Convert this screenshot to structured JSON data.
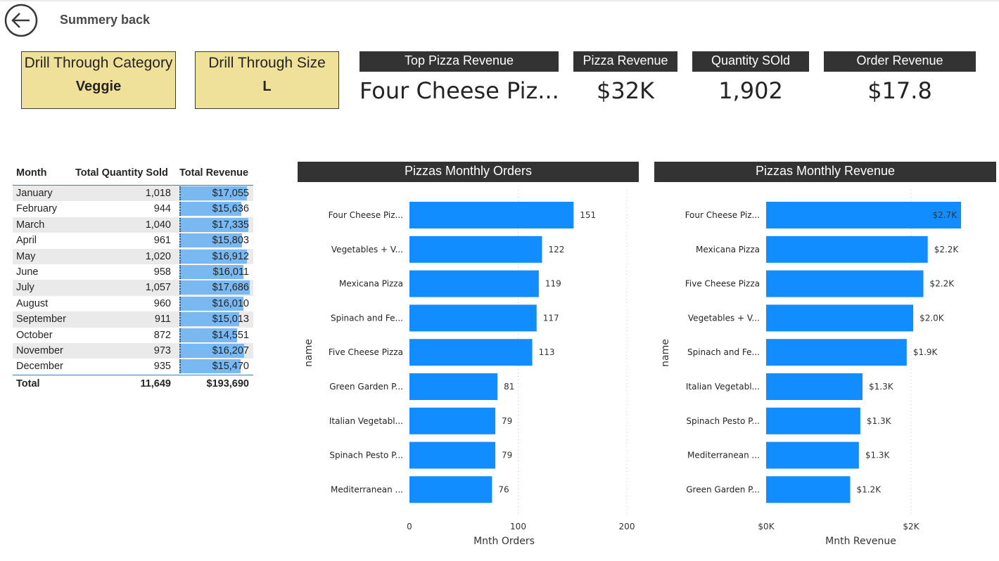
{
  "nav": {
    "back_label": "Summery back"
  },
  "drill": [
    {
      "title": "Drill Through Category",
      "value": "Veggie"
    },
    {
      "title": "Drill Through Size",
      "value": "L"
    }
  ],
  "kpis": [
    {
      "title": "Top Pizza Revenue",
      "value": "Four Cheese Piz..."
    },
    {
      "title": "Pizza Revenue",
      "value": "$32K"
    },
    {
      "title": "Quantity SOld",
      "value": "1,902"
    },
    {
      "title": "Order Revenue",
      "value": "$17.8"
    }
  ],
  "table": {
    "headers": [
      "Month",
      "Total Quantity Sold",
      "Total Revenue"
    ],
    "rows": [
      {
        "month": "January",
        "qty": "1,018",
        "rev": "$17,055",
        "rev_num": 17055
      },
      {
        "month": "February",
        "qty": "944",
        "rev": "$15,636",
        "rev_num": 15636
      },
      {
        "month": "March",
        "qty": "1,040",
        "rev": "$17,335",
        "rev_num": 17335
      },
      {
        "month": "April",
        "qty": "961",
        "rev": "$15,803",
        "rev_num": 15803
      },
      {
        "month": "May",
        "qty": "1,020",
        "rev": "$16,912",
        "rev_num": 16912
      },
      {
        "month": "June",
        "qty": "958",
        "rev": "$16,011",
        "rev_num": 16011
      },
      {
        "month": "July",
        "qty": "1,057",
        "rev": "$17,686",
        "rev_num": 17686
      },
      {
        "month": "August",
        "qty": "960",
        "rev": "$16,010",
        "rev_num": 16010
      },
      {
        "month": "September",
        "qty": "911",
        "rev": "$15,013",
        "rev_num": 15013
      },
      {
        "month": "October",
        "qty": "872",
        "rev": "$14,551",
        "rev_num": 14551
      },
      {
        "month": "November",
        "qty": "973",
        "rev": "$16,207",
        "rev_num": 16207
      },
      {
        "month": "December",
        "qty": "935",
        "rev": "$15,470",
        "rev_num": 15470
      }
    ],
    "total": {
      "label": "Total",
      "qty": "11,649",
      "rev": "$193,690"
    }
  },
  "colors": {
    "bar": "#118dff",
    "header_bg": "#333333",
    "drill_bg": "#f0e19a",
    "table_bar": "#79b8f0"
  },
  "chart_data": [
    {
      "type": "bar",
      "orientation": "horizontal",
      "title": "Pizzas Monthly Orders",
      "xlabel": "Mnth Orders",
      "ylabel": "name",
      "categories": [
        "Four Cheese Piz...",
        "Vegetables + V...",
        "Mexicana Pizza",
        "Spinach and Fe...",
        "Five Cheese Pizza",
        "Green Garden P...",
        "Italian Vegetabl...",
        "Spinach Pesto P...",
        "Mediterranean ..."
      ],
      "values": [
        151,
        122,
        119,
        117,
        113,
        81,
        79,
        79,
        76
      ],
      "data_labels": [
        "151",
        "122",
        "119",
        "117",
        "113",
        "81",
        "79",
        "79",
        "76"
      ],
      "xlim": [
        0,
        200
      ],
      "xticks": [
        0,
        100,
        200
      ],
      "xtick_labels": [
        "0",
        "100",
        "200"
      ],
      "grid": true
    },
    {
      "type": "bar",
      "orientation": "horizontal",
      "title": "Pizzas Monthly Revenue",
      "xlabel": "Mnth Revenue",
      "ylabel": "name",
      "categories": [
        "Four Cheese Piz...",
        "Mexicana Pizza",
        "Five Cheese Pizza",
        "Vegetables + V...",
        "Spinach and Fe...",
        "Italian Vegetabl...",
        "Spinach Pesto P...",
        "Mediterranean ...",
        "Green Garden P..."
      ],
      "values": [
        2690,
        2230,
        2170,
        2030,
        1940,
        1330,
        1300,
        1280,
        1160
      ],
      "data_labels": [
        "$2.7K",
        "$2.2K",
        "$2.2K",
        "$2.0K",
        "$1.9K",
        "$1.3K",
        "$1.3K",
        "$1.3K",
        "$1.2K"
      ],
      "xlim": [
        0,
        3000
      ],
      "xticks": [
        0,
        2000
      ],
      "xtick_labels": [
        "$0K",
        "$2K"
      ],
      "grid": true
    }
  ]
}
